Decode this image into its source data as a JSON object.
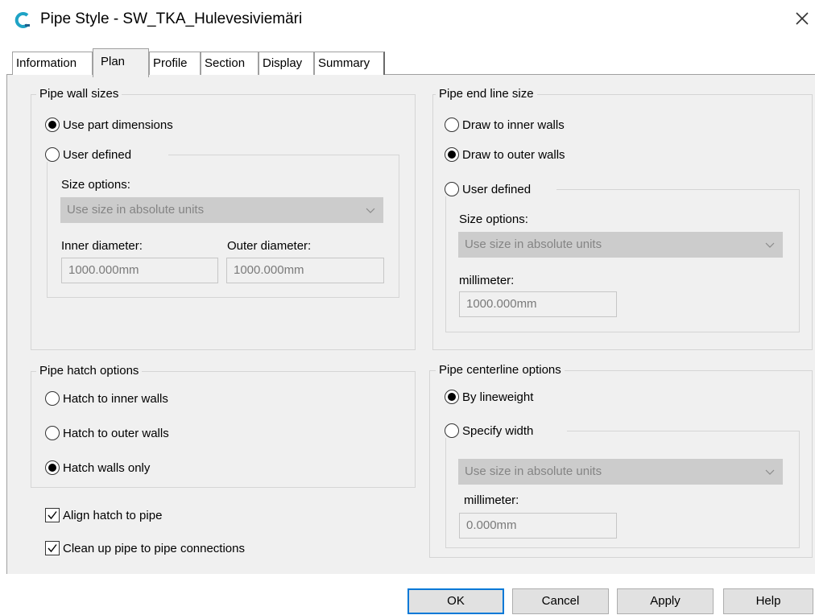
{
  "window": {
    "title": "Pipe Style - SW_TKA_Hulevesiviemäri",
    "app_icon": "civil3d-c-icon",
    "close_icon": "close-icon"
  },
  "tabs": [
    {
      "label": "Information",
      "active": false
    },
    {
      "label": "Plan",
      "active": true
    },
    {
      "label": "Profile",
      "active": false
    },
    {
      "label": "Section",
      "active": false
    },
    {
      "label": "Display",
      "active": false
    },
    {
      "label": "Summary",
      "active": false
    }
  ],
  "wall_sizes": {
    "title": "Pipe wall sizes",
    "option_part": "Use part dimensions",
    "option_user": "User defined",
    "selected": "part",
    "size_options_label": "Size options:",
    "size_options_value": "Use size in absolute units",
    "inner_label": "Inner diameter:",
    "inner_value": "1000.000mm",
    "outer_label": "Outer diameter:",
    "outer_value": "1000.000mm"
  },
  "end_line": {
    "title": "Pipe end line size",
    "option_inner": "Draw to inner walls",
    "option_outer": "Draw to outer walls",
    "option_user": "User defined",
    "selected": "outer",
    "size_options_label": "Size options:",
    "size_options_value": "Use size in absolute units",
    "unit_label": "millimeter:",
    "unit_value": "1000.000mm"
  },
  "hatch": {
    "title": "Pipe hatch options",
    "option_inner": "Hatch to inner walls",
    "option_outer": "Hatch to outer walls",
    "option_walls": "Hatch walls only",
    "selected": "walls"
  },
  "checks": {
    "align_label": "Align hatch to pipe",
    "align_checked": true,
    "cleanup_label": "Clean up pipe to pipe connections",
    "cleanup_checked": true
  },
  "centerline": {
    "title": "Pipe centerline options",
    "option_lineweight": "By lineweight",
    "option_width": "Specify width",
    "selected": "lineweight",
    "size_options_value": "Use size in absolute units",
    "unit_label": "millimeter:",
    "unit_value": "0.000mm"
  },
  "buttons": {
    "ok": "OK",
    "cancel": "Cancel",
    "apply": "Apply",
    "help": "Help"
  },
  "colors": {
    "accent": "#0078d7",
    "panel": "#f0f0f0",
    "disabled_combo": "#cccccc",
    "app_icon_cyan": "#1fa3c5"
  }
}
